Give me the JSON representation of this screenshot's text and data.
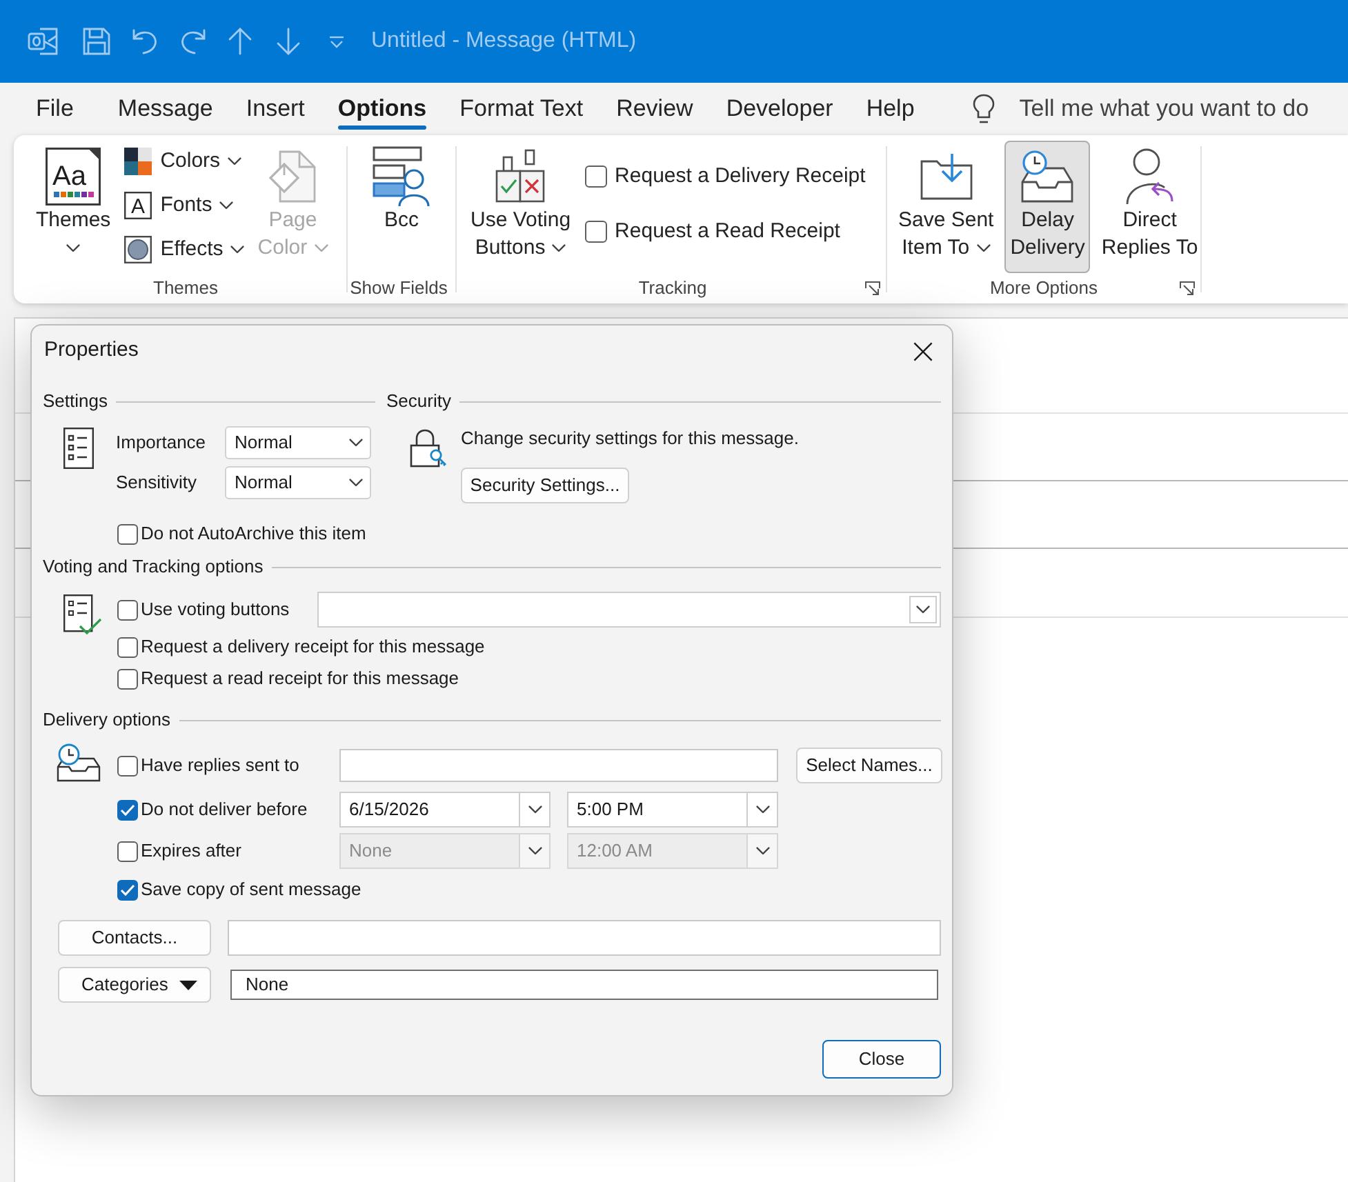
{
  "title_bar": {
    "title": "Untitled - Message (HTML)"
  },
  "menu_tabs": [
    {
      "label": "File",
      "selected": false
    },
    {
      "label": "Message",
      "selected": false
    },
    {
      "label": "Insert",
      "selected": false
    },
    {
      "label": "Options",
      "selected": true
    },
    {
      "label": "Format Text",
      "selected": false
    },
    {
      "label": "Review",
      "selected": false
    },
    {
      "label": "Developer",
      "selected": false
    },
    {
      "label": "Help",
      "selected": false
    }
  ],
  "tell_me": {
    "placeholder": "Tell me what you want to do"
  },
  "ribbon": {
    "groups": [
      {
        "label": "Themes",
        "launcher": false,
        "items": [
          {
            "kind": "large",
            "lines": [
              "Themes"
            ],
            "icon_text": "Aa",
            "dropdown": true,
            "disabled": false,
            "pressed": false
          },
          {
            "kind": "small_stack",
            "buttons": [
              {
                "label": "Colors",
                "dropdown": true
              },
              {
                "label": "Fonts",
                "icon_text": "A",
                "dropdown": true
              },
              {
                "label": "Effects",
                "dropdown": true
              }
            ]
          },
          {
            "kind": "large",
            "lines": [
              "Page",
              "Color"
            ],
            "dropdown": true,
            "disabled": true,
            "pressed": false
          }
        ]
      },
      {
        "label": "Show Fields",
        "launcher": false,
        "items": [
          {
            "kind": "large",
            "lines": [
              "Bcc"
            ],
            "dropdown": false,
            "disabled": false,
            "pressed": false
          }
        ]
      },
      {
        "label": "Tracking",
        "launcher": true,
        "items": [
          {
            "kind": "large",
            "lines": [
              "Use Voting",
              "Buttons"
            ],
            "dropdown": true,
            "disabled": false,
            "pressed": false
          },
          {
            "kind": "check_stack",
            "checks": [
              {
                "label": "Request a Delivery Receipt",
                "checked": false
              },
              {
                "label": "Request a Read Receipt",
                "checked": false
              }
            ]
          }
        ]
      },
      {
        "label": "More Options",
        "launcher": true,
        "items": [
          {
            "kind": "large",
            "lines": [
              "Save Sent",
              "Item To"
            ],
            "dropdown": true,
            "disabled": false,
            "pressed": false
          },
          {
            "kind": "large",
            "lines": [
              "Delay",
              "Delivery"
            ],
            "dropdown": false,
            "disabled": false,
            "pressed": true
          },
          {
            "kind": "large",
            "lines": [
              "Direct",
              "Replies To"
            ],
            "dropdown": false,
            "disabled": false,
            "pressed": false
          }
        ]
      }
    ]
  },
  "dialog": {
    "title": "Properties",
    "settings": {
      "heading": "Settings",
      "fields": [
        {
          "label": "Importance",
          "value": "Normal"
        },
        {
          "label": "Sensitivity",
          "value": "Normal"
        }
      ],
      "checks": [
        {
          "label": "Do not AutoArchive this item",
          "checked": false
        }
      ]
    },
    "security": {
      "heading": "Security",
      "text": "Change security settings for this message.",
      "button": "Security Settings..."
    },
    "voting": {
      "heading": "Voting and Tracking options",
      "checks": [
        {
          "label": "Use voting buttons",
          "checked": false
        },
        {
          "label": "Request a delivery receipt for this message",
          "checked": false
        },
        {
          "label": "Request a read receipt for this message",
          "checked": false
        }
      ]
    },
    "delivery": {
      "heading": "Delivery options",
      "replies": {
        "label": "Have replies sent to",
        "checked": false,
        "button": "Select Names..."
      },
      "schedule": [
        {
          "label": "Do not deliver before",
          "checked": true,
          "date": "6/15/2026",
          "time": "5:00 PM",
          "disabled": false
        },
        {
          "label": "Expires after",
          "checked": false,
          "date": "None",
          "time": "12:00 AM",
          "disabled": true
        }
      ],
      "save_copy": {
        "label": "Save copy of sent message",
        "checked": true
      }
    },
    "contacts": {
      "button": "Contacts..."
    },
    "categories": {
      "button": "Categories",
      "value": "None"
    },
    "close_button": "Close"
  }
}
